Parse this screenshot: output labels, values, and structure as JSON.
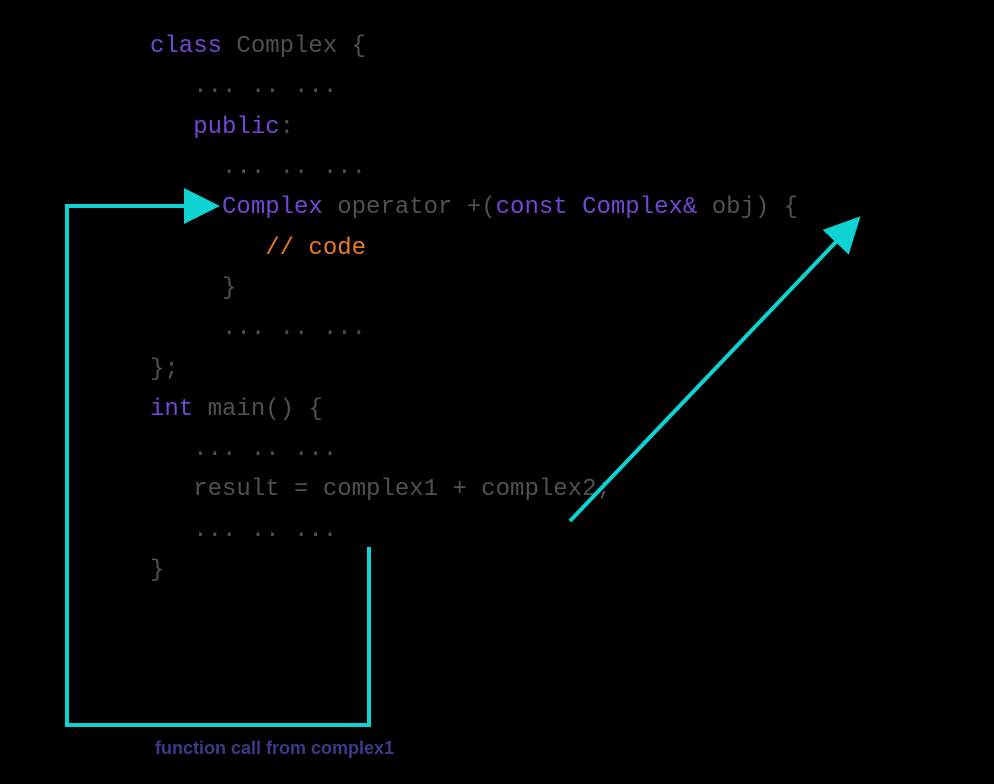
{
  "code": {
    "line1_class": "class",
    "line1_rest": " Complex {",
    "line2": "   ... .. ...",
    "line3_public": "   public",
    "line3_rest": ":",
    "line4": "     ... .. ...",
    "line5_complex1": "     Complex",
    "line5_operator": " operator +(",
    "line5_const": "const",
    "line5_complex2": " Complex&",
    "line5_rest": " obj) {",
    "line6_comment": "        // code",
    "line7": "     }",
    "line8": "     ... .. ...",
    "line9": "};",
    "line10": "",
    "line11_int": "int",
    "line11_rest": " main() {",
    "line12": "   ... .. ...",
    "line13": "   result = complex1 + complex2;",
    "line14": "   ... .. ...",
    "line15": "}"
  },
  "caption": "function call from complex1",
  "arrows": {
    "color": "#0dd3d3"
  }
}
